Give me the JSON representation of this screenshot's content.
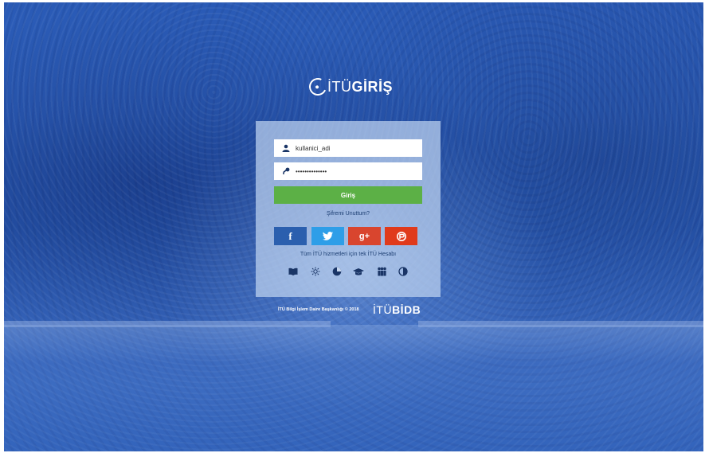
{
  "brand": {
    "logo_part1": "İTÜ",
    "logo_part2": "GİRİŞ"
  },
  "login": {
    "username_value": "kullanici_adi",
    "password_value": "••••••••••••••",
    "submit_label": "Giriş",
    "forgot_link": "Şifremi Unuttum?"
  },
  "social": {
    "facebook_glyph": "f",
    "google_plus_glyph": "g+"
  },
  "services": {
    "tagline": "Tüm İTÜ hizmetleri için tek İTÜ Hesabı",
    "icons": [
      "book-icon",
      "sun-icon",
      "pie-chart-icon",
      "graduation-cap-icon",
      "people-icon",
      "contrast-icon"
    ]
  },
  "footer": {
    "copyright": "İTÜ Bilgi İşlem Daire Başkanlığı © 2018",
    "logo_part1": "İTÜ",
    "logo_part2": "BİDB"
  },
  "colors": {
    "background": "#2e61bd",
    "panel": "#bed2f0",
    "login_button": "#5cb046",
    "facebook": "#2b5fae",
    "twitter": "#2e9ee8",
    "google_plus": "#d9452e",
    "extra": "#e03a1b"
  }
}
